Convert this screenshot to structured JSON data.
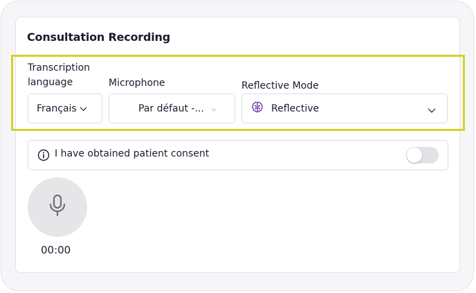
{
  "card": {
    "title": "Consultation Recording"
  },
  "language": {
    "label": "Transcription language",
    "value": "Français"
  },
  "microphone": {
    "label": "Microphone",
    "value": "Par défaut -..."
  },
  "mode": {
    "label": "Reflective Mode",
    "value": "Reflective"
  },
  "consent": {
    "label": "I have obtained patient consent",
    "checked": false
  },
  "recorder": {
    "time": "00:00"
  },
  "colors": {
    "highlight": "#d4d22b",
    "brain_icon": "#6b3fa0",
    "mic_button": "#e6e6e9"
  },
  "icons": {
    "language_chevron": "chevron-down-icon",
    "mode_icon": "brain-icon",
    "info": "info-icon",
    "record": "microphone-icon"
  }
}
